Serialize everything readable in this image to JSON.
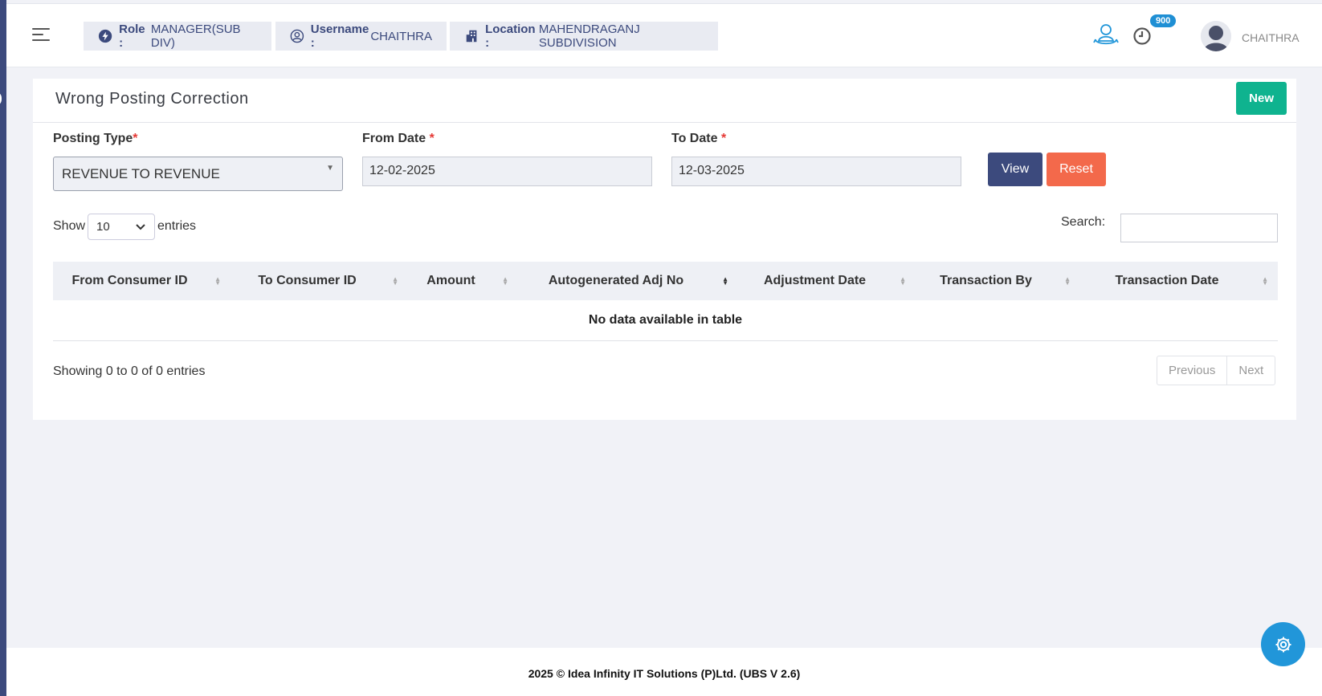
{
  "header": {
    "role_key": "Role :",
    "role_value": "MANAGER(SUB DIV)",
    "username_key": "Username :",
    "username_value": "CHAITHRA",
    "location_key": "Location :",
    "location_value": "MAHENDRAGANJ SUBDIVISION",
    "notification_count": "900",
    "user_name": "CHAITHRA"
  },
  "page": {
    "title": "Wrong Posting Correction",
    "new_label": "New"
  },
  "form": {
    "posting_type_label": "Posting Type",
    "posting_type_value": "REVENUE TO REVENUE",
    "from_date_label": "From Date",
    "from_date_value": "12-02-2025",
    "to_date_label": "To Date",
    "to_date_value": "12-03-2025",
    "required_mark": "*",
    "view_label": "View",
    "reset_label": "Reset"
  },
  "table": {
    "show_label": "Show",
    "entries_value": "10",
    "entries_label": "entries",
    "search_label": "Search:",
    "columns": [
      "From Consumer ID",
      "To Consumer ID",
      "Amount",
      "Autogenerated Adj No",
      "Adjustment Date",
      "Transaction By",
      "Transaction Date"
    ],
    "empty_text": "No data available in table",
    "info_text": "Showing 0 to 0 of 0 entries",
    "prev_label": "Previous",
    "next_label": "Next"
  },
  "footer": {
    "text": "2025 © Idea Infinity IT Solutions (P)Ltd. (UBS V 2.6)"
  },
  "colors": {
    "primary": "#3c4a7d",
    "success": "#0fb38f",
    "danger": "#f3694b",
    "info": "#2196d9"
  }
}
